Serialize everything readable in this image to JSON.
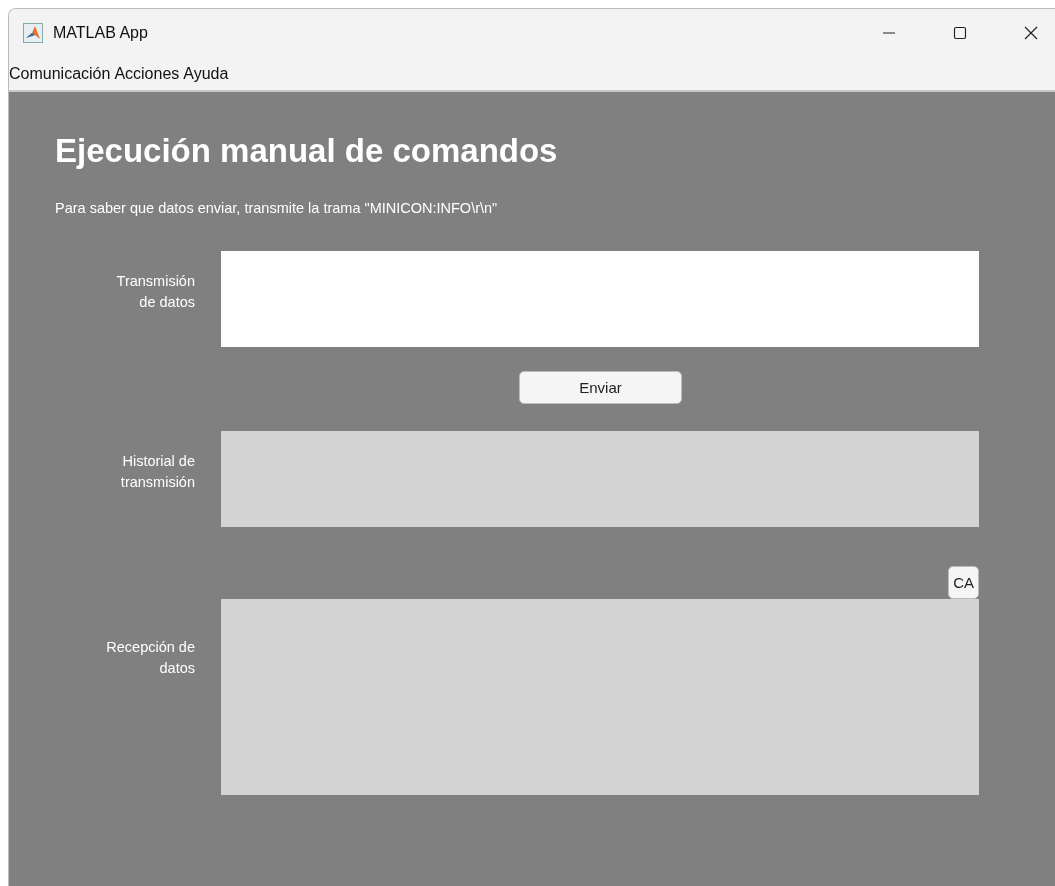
{
  "window": {
    "title": "MATLAB App"
  },
  "menu": [
    "Comunicación",
    "Acciones",
    "Ayuda"
  ],
  "heading": "Ejecución manual de comandos",
  "instruction": "Para saber que datos enviar, transmite la trama \"MINICON:INFO\\r\\n\"",
  "sections": [
    {
      "kind": "input",
      "label_lines": [
        "Transmisión",
        "de datos"
      ],
      "editable": true,
      "button": "Enviar"
    },
    {
      "kind": "history",
      "label_lines": [
        "Historial de",
        "transmisión"
      ],
      "editable": false
    },
    {
      "kind": "reception",
      "label_lines": [
        "Recepción de",
        "datos"
      ],
      "editable": false,
      "corner_button": "CA"
    }
  ]
}
